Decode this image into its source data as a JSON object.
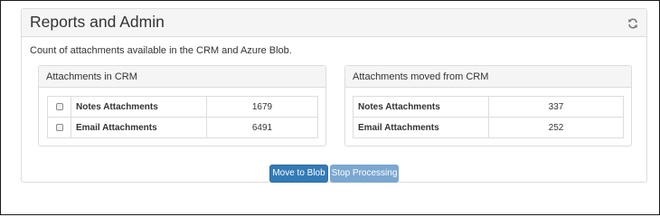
{
  "panel": {
    "title": "Reports and Admin",
    "refresh_icon": "refresh-icon"
  },
  "description": "Count of attachments available in the CRM and Azure Blob.",
  "crm_panel": {
    "title": "Attachments in CRM",
    "rows": [
      {
        "label": "Notes Attachments",
        "count": "1679",
        "checked": false
      },
      {
        "label": "Email Attachments",
        "count": "6491",
        "checked": false
      }
    ]
  },
  "moved_panel": {
    "title": "Attachments moved from CRM",
    "rows": [
      {
        "label": "Notes Attachments",
        "count": "337"
      },
      {
        "label": "Email Attachments",
        "count": "252"
      }
    ]
  },
  "buttons": {
    "move_label": "Move to Blob",
    "stop_label": "Stop Processing",
    "stop_disabled": true
  },
  "colors": {
    "primary": "#337ab7",
    "primary_disabled": "#7ba7d1",
    "panel_heading": "#f5f5f5",
    "border": "#dddddd"
  }
}
